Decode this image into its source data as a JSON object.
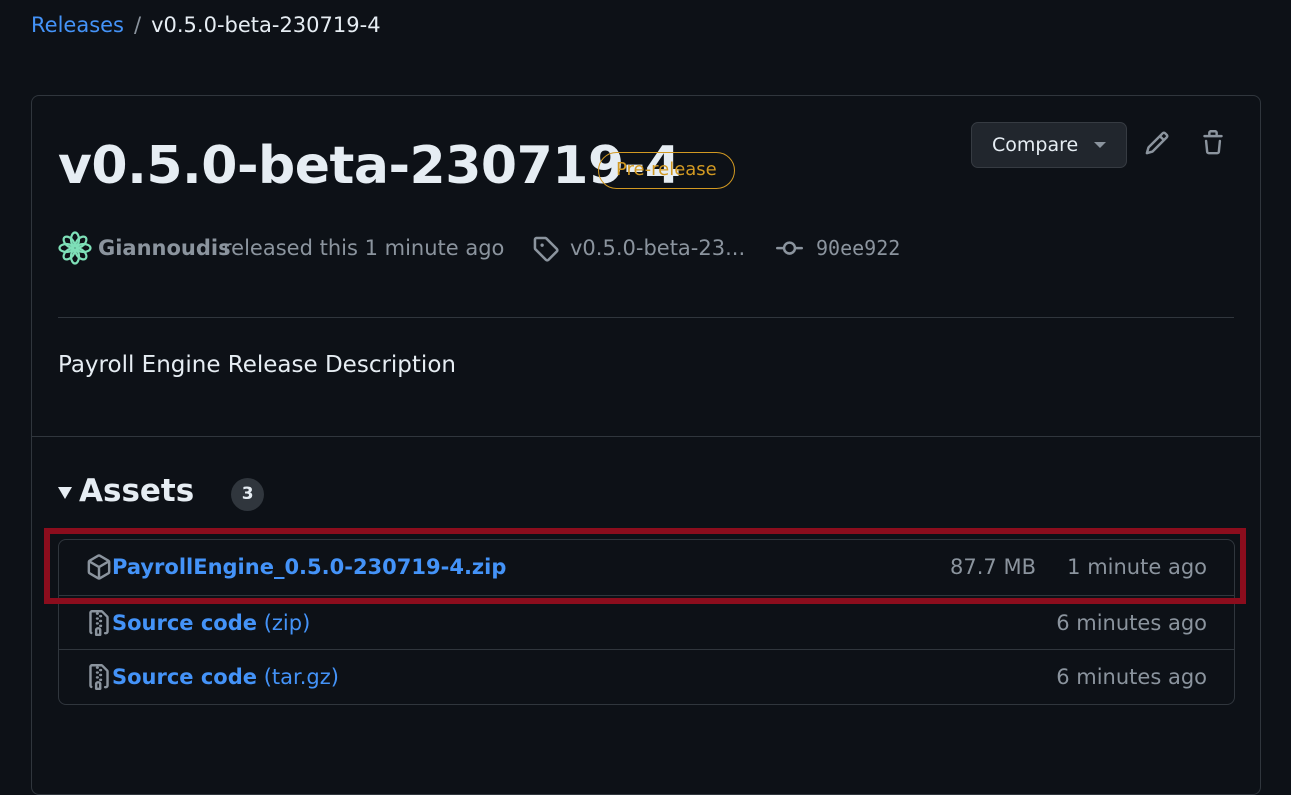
{
  "breadcrumb": {
    "root": "Releases",
    "separator": "/",
    "current": "v0.5.0-beta-230719-4"
  },
  "release": {
    "title": "v0.5.0-beta-230719-4",
    "badge": "Pre-release",
    "compare_label": "Compare",
    "author": "Giannoudis",
    "released_text": "released this 1 minute ago",
    "tag": "v0.5.0-beta-23...",
    "commit": "90ee922",
    "description": "Payroll Engine Release Description"
  },
  "assets": {
    "label": "Assets",
    "count": "3",
    "items": [
      {
        "name": "PayrollEngine_0.5.0-230719-4.zip",
        "ext": "",
        "size": "87.7 MB",
        "time": "1 minute ago",
        "icon": "package-icon"
      },
      {
        "name": "Source code",
        "ext": "(zip)",
        "size": "",
        "time": "6 minutes ago",
        "icon": "file-zip-icon"
      },
      {
        "name": "Source code",
        "ext": "(tar.gz)",
        "size": "",
        "time": "6 minutes ago",
        "icon": "file-zip-icon"
      }
    ]
  },
  "colors": {
    "accent_link": "#4493f8",
    "prerelease": "#d29922",
    "highlight": "#8b0d1d",
    "background": "#0d1117"
  }
}
